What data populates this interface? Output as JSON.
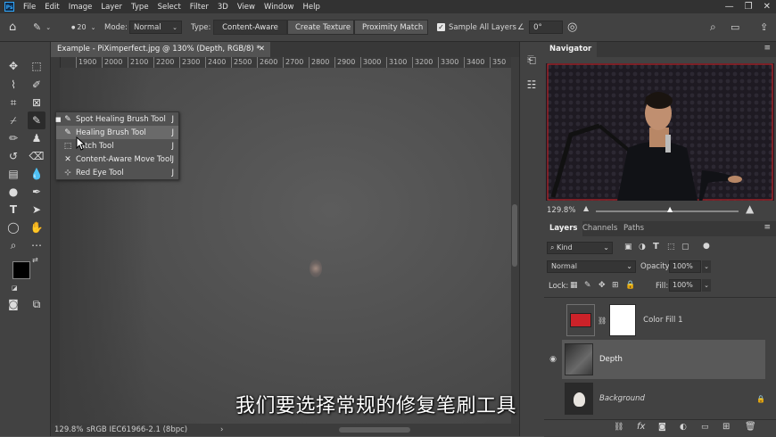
{
  "menu": [
    "File",
    "Edit",
    "Image",
    "Layer",
    "Type",
    "Select",
    "Filter",
    "3D",
    "View",
    "Window",
    "Help"
  ],
  "options": {
    "brush_size": "20",
    "mode_label": "Mode:",
    "mode_value": "Normal",
    "type_label": "Type:",
    "type_buttons": [
      "Content-Aware",
      "Create Texture",
      "Proximity Match"
    ],
    "sample_all_layers": "Sample All Layers",
    "angle_value": "0°"
  },
  "document": {
    "tab_title": "Example - PiXimperfect.jpg @ 130% (Depth, RGB/8) *",
    "ruler_ticks": [
      "1900",
      "2000",
      "2100",
      "2200",
      "2300",
      "2400",
      "2500",
      "2600",
      "2700",
      "2800",
      "2900",
      "3000",
      "3100",
      "3200",
      "3300",
      "3400",
      "350"
    ],
    "status_zoom": "129.8%",
    "status_profile": "sRGB IEC61966-2.1 (8bpc)"
  },
  "flyout": {
    "items": [
      {
        "label": "Spot Healing Brush Tool",
        "key": "J"
      },
      {
        "label": "Healing Brush Tool",
        "key": "J"
      },
      {
        "label": "Patch Tool",
        "key": "J"
      },
      {
        "label": "Content-Aware Move Tool",
        "key": "J"
      },
      {
        "label": "Red Eye Tool",
        "key": "J"
      }
    ]
  },
  "navigator": {
    "title": "Navigator",
    "zoom": "129.8%"
  },
  "layers_panel": {
    "tabs": [
      "Layers",
      "Channels",
      "Paths"
    ],
    "filter_kind": "Kind",
    "blend_mode": "Normal",
    "opacity_label": "Opacity:",
    "opacity_value": "100%",
    "lock_label": "Lock:",
    "fill_label": "Fill:",
    "fill_value": "100%",
    "layers": [
      {
        "name": "Color Fill 1"
      },
      {
        "name": "Depth"
      },
      {
        "name": "Background"
      }
    ]
  },
  "subtitle": "我们要选择常规的修复笔刷工具",
  "colors": {
    "foreground": "#000000",
    "background": "#ffffff",
    "color_fill": "#cc2229",
    "accent": "#31a8ff"
  }
}
